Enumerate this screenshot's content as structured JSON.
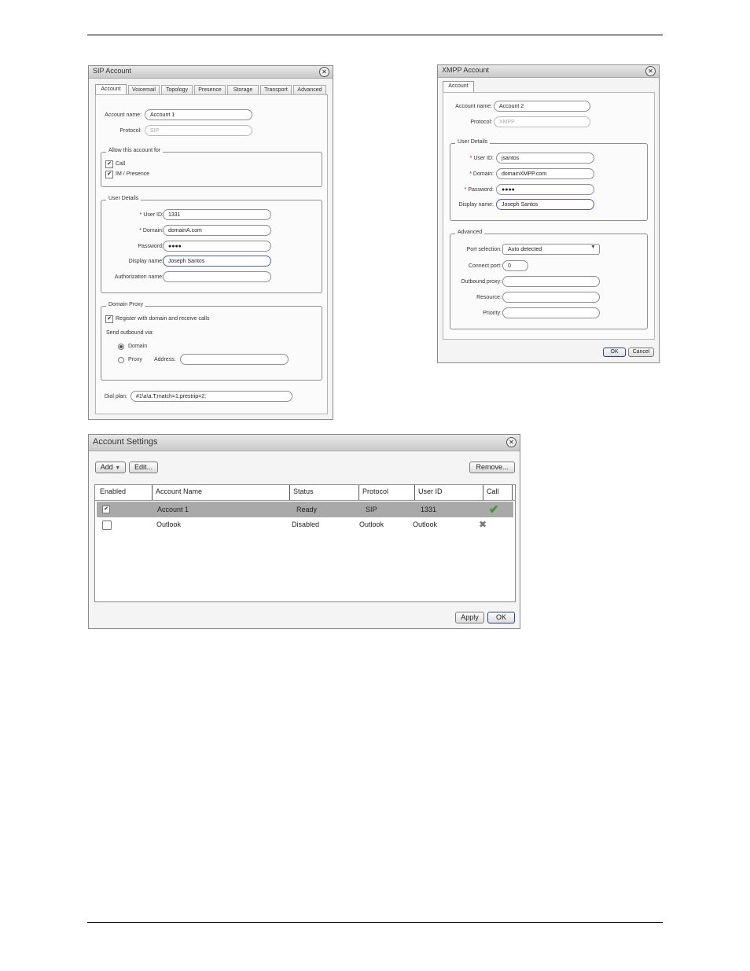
{
  "sip": {
    "title": "SIP Account",
    "tabs": [
      "Account",
      "Voicemail",
      "Topology",
      "Presence",
      "Storage",
      "Transport",
      "Advanced"
    ],
    "account_name_label": "Account name:",
    "account_name_value": "Account 1",
    "protocol_label": "Protocol:",
    "protocol_value": "SIP",
    "allow_group": "Allow this account for",
    "allow_call": "Call",
    "allow_im": "IM / Presence",
    "user_group": "User Details",
    "user_id_label": "User ID:",
    "user_id_value": "1331",
    "domain_label": "Domain:",
    "domain_value": "domainA.com",
    "password_label": "Password:",
    "password_value": "●●●●",
    "display_label": "Display name:",
    "display_value": "Joseph Santos",
    "auth_label": "Authorization name:",
    "auth_value": "",
    "proxy_group": "Domain Proxy",
    "register_label": "Register with domain and receive calls",
    "send_via": "Send outbound via:",
    "opt_domain": "Domain",
    "opt_proxy": "Proxy",
    "address_label": "Address:",
    "address_value": "",
    "dial_plan_label": "Dial plan:",
    "dial_plan_value": "#1\\a\\a.T;match=1;prestrip=2;"
  },
  "xmpp": {
    "title": "XMPP Account",
    "tab": "Account",
    "account_name_label": "Account name:",
    "account_name_value": "Account 2",
    "protocol_label": "Protocol:",
    "protocol_value": "XMPP",
    "user_group": "User Details",
    "user_id_label": "User ID:",
    "user_id_value": "jsantos",
    "domain_label": "Domain:",
    "domain_value": "domainXMPP.com",
    "password_label": "Password:",
    "password_value": "●●●●",
    "display_label": "Display name:",
    "display_value": "Joseph Santos",
    "adv_group": "Advanced",
    "port_sel_label": "Port selection:",
    "port_sel_value": "Auto detected",
    "connect_port_label": "Connect port:",
    "connect_port_value": "0",
    "outbound_proxy_label": "Outbound proxy:",
    "resource_label": "Resource:",
    "priority_label": "Priority:",
    "ok": "OK",
    "cancel": "Cancel"
  },
  "settings": {
    "title": "Account Settings",
    "add": "Add",
    "edit": "Edit...",
    "remove": "Remove...",
    "columns": [
      "Enabled",
      "Account Name",
      "Status",
      "Protocol",
      "User ID",
      "Call"
    ],
    "rows": [
      {
        "enabled": "✔",
        "name": "Account 1",
        "status": "Ready",
        "protocol": "SIP",
        "user_id": "1331",
        "call": "✔"
      },
      {
        "enabled": "",
        "name": "Outlook",
        "status": "Disabled",
        "protocol": "Outlook",
        "user_id": "Outlook",
        "call": "✖"
      }
    ],
    "apply": "Apply",
    "ok": "OK",
    "colors": {
      "selected_row": "#a9a9a9",
      "call_ok": "#3a9a2a",
      "call_x": "#777777"
    }
  }
}
